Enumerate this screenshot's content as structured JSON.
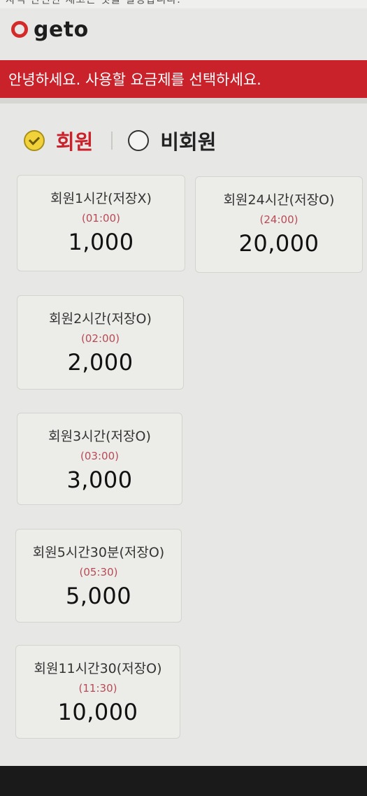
{
  "header": {
    "cut_text": "자격 안전한 재고는 것을 설정합니다.",
    "logo_text": "geto",
    "banner_text": "안녕하세요. 사용할 요금제를 선택하세요."
  },
  "member_tabs": [
    {
      "label": "회원",
      "selected": true
    },
    {
      "label": "비회원",
      "selected": false
    }
  ],
  "plans": [
    {
      "name": "회원1시간(저장X)",
      "time": "(01:00)",
      "price": "1,000"
    },
    {
      "name": "회원24시간(저장O)",
      "time": "(24:00)",
      "price": "20,000"
    },
    {
      "name": "회원2시간(저장O)",
      "time": "(02:00)",
      "price": "2,000"
    },
    {
      "name": "회원3시간(저장O)",
      "time": "(03:00)",
      "price": "3,000"
    },
    {
      "name": "회원5시간30분(저장O)",
      "time": "(05:30)",
      "price": "5,000"
    },
    {
      "name": "회원11시간30(저장O)",
      "time": "(11:30)",
      "price": "10,000"
    }
  ],
  "colors": {
    "accent": "#c9222b",
    "check_fill": "#f2d23a",
    "time_text": "#b84a55"
  }
}
